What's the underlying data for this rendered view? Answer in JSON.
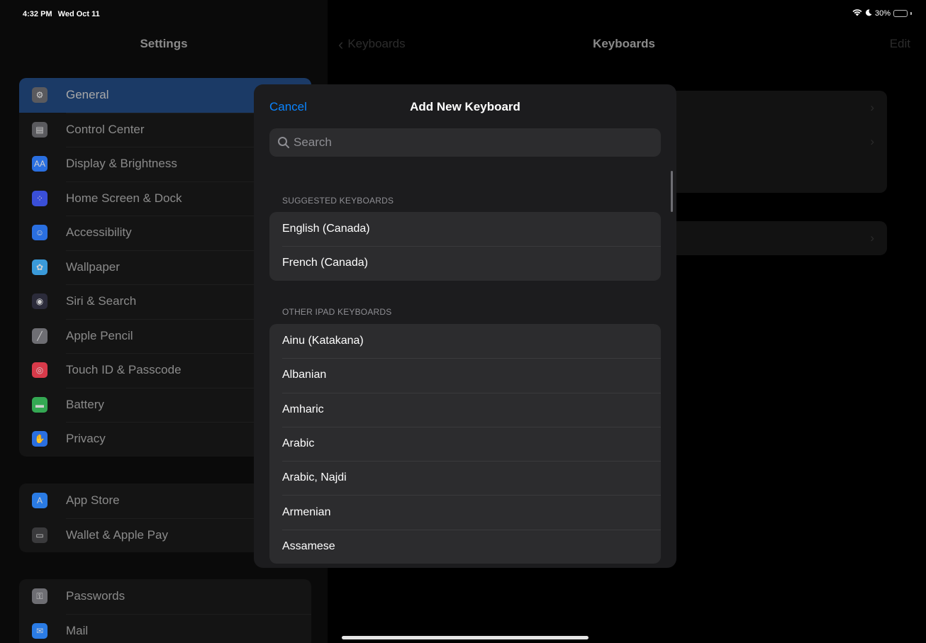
{
  "status": {
    "time": "4:32 PM",
    "date": "Wed Oct 11",
    "battery": "30%",
    "battery_level": 0.3
  },
  "sidebar": {
    "title": "Settings",
    "groups": [
      [
        {
          "label": "General",
          "icon": "gear-icon",
          "color": "#5a5a5e",
          "glyph": "⚙"
        },
        {
          "label": "Control Center",
          "icon": "toggles-icon",
          "color": "#5a5a5e",
          "glyph": "▤"
        },
        {
          "label": "Display & Brightness",
          "icon": "text-size-icon",
          "color": "#2a6fe0",
          "glyph": "AA"
        },
        {
          "label": "Home Screen & Dock",
          "icon": "home-grid-icon",
          "color": "#3a4fd8",
          "glyph": "⁘"
        },
        {
          "label": "Accessibility",
          "icon": "accessibility-icon",
          "color": "#2a6fe0",
          "glyph": "☺"
        },
        {
          "label": "Wallpaper",
          "icon": "wallpaper-icon",
          "color": "#3a9ad9",
          "glyph": "✿"
        },
        {
          "label": "Siri & Search",
          "icon": "siri-icon",
          "color": "#2b2b3a",
          "glyph": "◉"
        },
        {
          "label": "Apple Pencil",
          "icon": "pencil-icon",
          "color": "#6e6e73",
          "glyph": "╱"
        },
        {
          "label": "Touch ID & Passcode",
          "icon": "fingerprint-icon",
          "color": "#d83a4a",
          "glyph": "◎"
        },
        {
          "label": "Battery",
          "icon": "battery-icon",
          "color": "#34a853",
          "glyph": "▬"
        },
        {
          "label": "Privacy",
          "icon": "hand-icon",
          "color": "#2a6fe0",
          "glyph": "✋"
        }
      ],
      [
        {
          "label": "App Store",
          "icon": "app-store-icon",
          "color": "#2a7be4",
          "glyph": "A"
        },
        {
          "label": "Wallet & Apple Pay",
          "icon": "wallet-icon",
          "color": "#3a3a3c",
          "glyph": "▭"
        }
      ],
      [
        {
          "label": "Passwords",
          "icon": "key-icon",
          "color": "#6e6e73",
          "glyph": "⚿"
        },
        {
          "label": "Mail",
          "icon": "mail-icon",
          "color": "#2a7be4",
          "glyph": "✉"
        }
      ]
    ],
    "selected_index": 0
  },
  "detail": {
    "back_label": "Keyboards",
    "title": "Keyboards",
    "edit_label": "Edit"
  },
  "modal": {
    "cancel_label": "Cancel",
    "title": "Add New Keyboard",
    "search_placeholder": "Search",
    "suggested_header": "SUGGESTED KEYBOARDS",
    "suggested": [
      "English (Canada)",
      "French (Canada)"
    ],
    "other_header": "OTHER IPAD KEYBOARDS",
    "other": [
      "Ainu (Katakana)",
      "Albanian",
      "Amharic",
      "Arabic",
      "Arabic, Najdi",
      "Armenian",
      "Assamese"
    ]
  },
  "colors": {
    "accent": "#0a84ff",
    "selected_row": "#1b3a66",
    "modal_bg": "#1c1c1e",
    "row_bg": "#2c2c2e"
  }
}
